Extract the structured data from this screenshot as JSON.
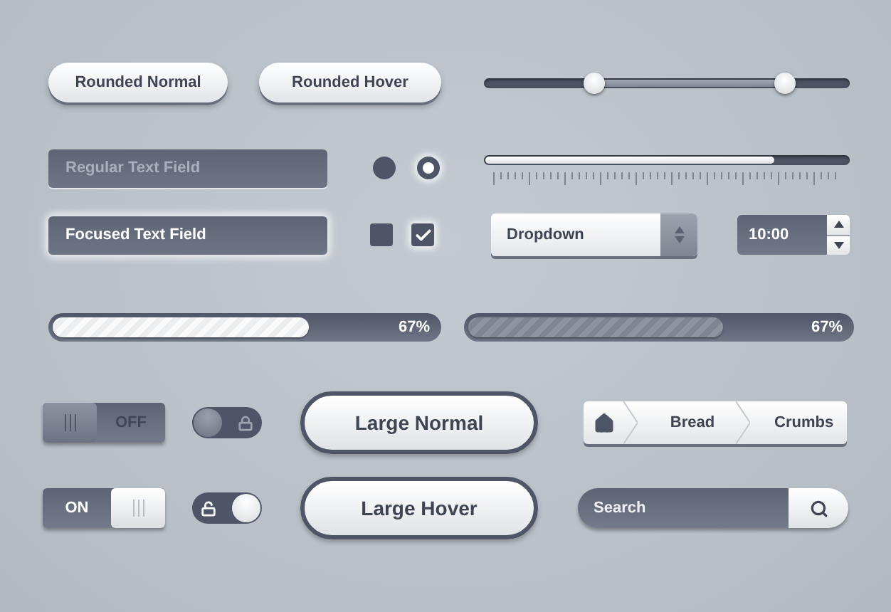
{
  "buttons": [
    {
      "label": "Rounded Normal"
    },
    {
      "label": "Rounded Hover"
    }
  ],
  "range_slider": {
    "thumbs": [
      {
        "level": 0.3
      },
      {
        "level": 0.82
      }
    ]
  },
  "slider": {
    "level": 0.79
  },
  "text_fields": [
    {
      "placeholder": "Regular Text Field",
      "focused": false
    },
    {
      "value": "Focused Text Field",
      "focused": true
    }
  ],
  "radios": [
    {
      "selected": false
    },
    {
      "selected": true
    }
  ],
  "checkboxes": [
    {
      "checked": false
    },
    {
      "checked": true
    }
  ],
  "dropdown": {
    "value": "Dropdown"
  },
  "time_stepper": {
    "value": "10:00"
  },
  "progress_bars": [
    {
      "kind": "light",
      "level": 0.68,
      "reading": "67%"
    },
    {
      "kind": "dark",
      "level": 0.68,
      "reading": "67%"
    }
  ],
  "toggles": [
    {
      "label": "OFF",
      "on": false
    },
    {
      "label": "ON",
      "on": true
    }
  ],
  "lock_switches": [
    {
      "on": false
    },
    {
      "on": true
    }
  ],
  "large_buttons": [
    {
      "label": "Large Normal"
    },
    {
      "label": "Large Hover"
    }
  ],
  "breadcrumbs": [
    {
      "kind": "home"
    },
    {
      "kind": "text",
      "label": "Bread"
    },
    {
      "kind": "text",
      "label": "Crumbs"
    }
  ],
  "search": {
    "placeholder": "Search"
  }
}
